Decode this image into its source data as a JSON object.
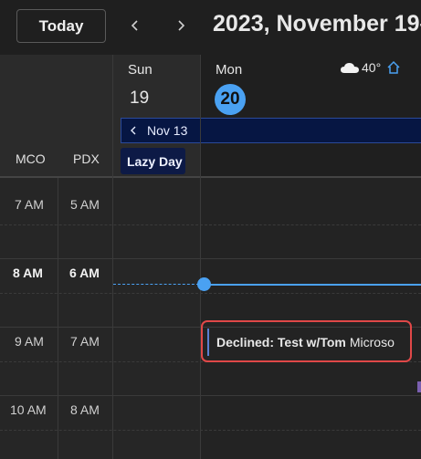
{
  "toolbar": {
    "today_label": "Today",
    "prev_icon": "chevron-left-icon",
    "next_icon": "chevron-right-icon",
    "title": "2023, November 19–"
  },
  "timezones": {
    "primary": "MCO",
    "secondary": "PDX"
  },
  "days": [
    {
      "name": "Sun",
      "number": "19",
      "is_today": false
    },
    {
      "name": "Mon",
      "number": "20",
      "is_today": true
    }
  ],
  "weather": {
    "icon": "cloud-icon",
    "temperature": "40°",
    "home_icon": "home-icon"
  },
  "banner": {
    "label": "Nov 13",
    "icon": "chevron-left-icon"
  },
  "all_day_event": {
    "label": "Lazy Day"
  },
  "hours": [
    {
      "primary": "7 AM",
      "secondary": "5 AM",
      "current": false
    },
    {
      "primary": "8 AM",
      "secondary": "6 AM",
      "current": true
    },
    {
      "primary": "9 AM",
      "secondary": "7 AM",
      "current": false
    },
    {
      "primary": "10 AM",
      "secondary": "8 AM",
      "current": false
    }
  ],
  "event": {
    "status": "Declined: Test w/Tom",
    "location": "Microso"
  },
  "colors": {
    "accent": "#4aa1f2",
    "highlight_outline": "#e04848",
    "all_day_bg": "#0d1a46"
  }
}
